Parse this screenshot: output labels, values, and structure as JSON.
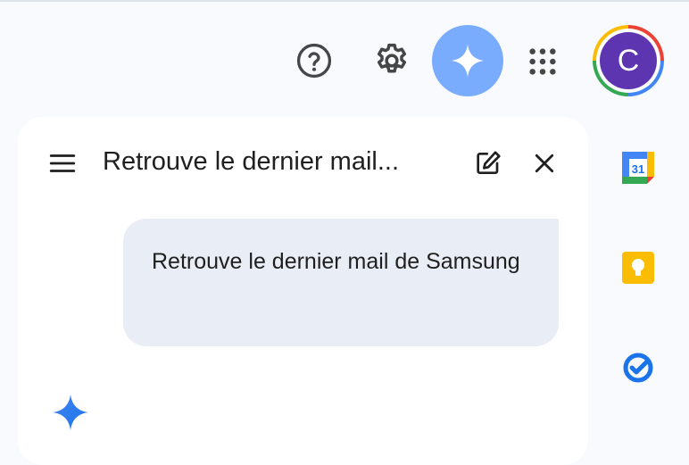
{
  "header": {
    "icons": [
      "help-icon",
      "gear-icon",
      "gemini-sparkle-icon",
      "apps-grid-icon"
    ],
    "account": {
      "initial": "C",
      "avatar_color": "#5e35b1"
    }
  },
  "panel": {
    "title": "Retrouve le dernier mail...",
    "icons": [
      "menu-icon",
      "edit-icon",
      "close-icon"
    ]
  },
  "conversation": {
    "user_message": "Retrouve le dernier mail de Samsung",
    "response_icon": "gemini-sparkle-icon"
  },
  "side_apps": [
    "calendar-icon",
    "keep-icon",
    "tasks-icon"
  ],
  "side_apps_labels": {
    "calendar_day": "31"
  },
  "colors": {
    "gemini_accent": "#7aacfe",
    "gemini_blue": "#1a73e8",
    "bubble": "#e9eef6"
  }
}
